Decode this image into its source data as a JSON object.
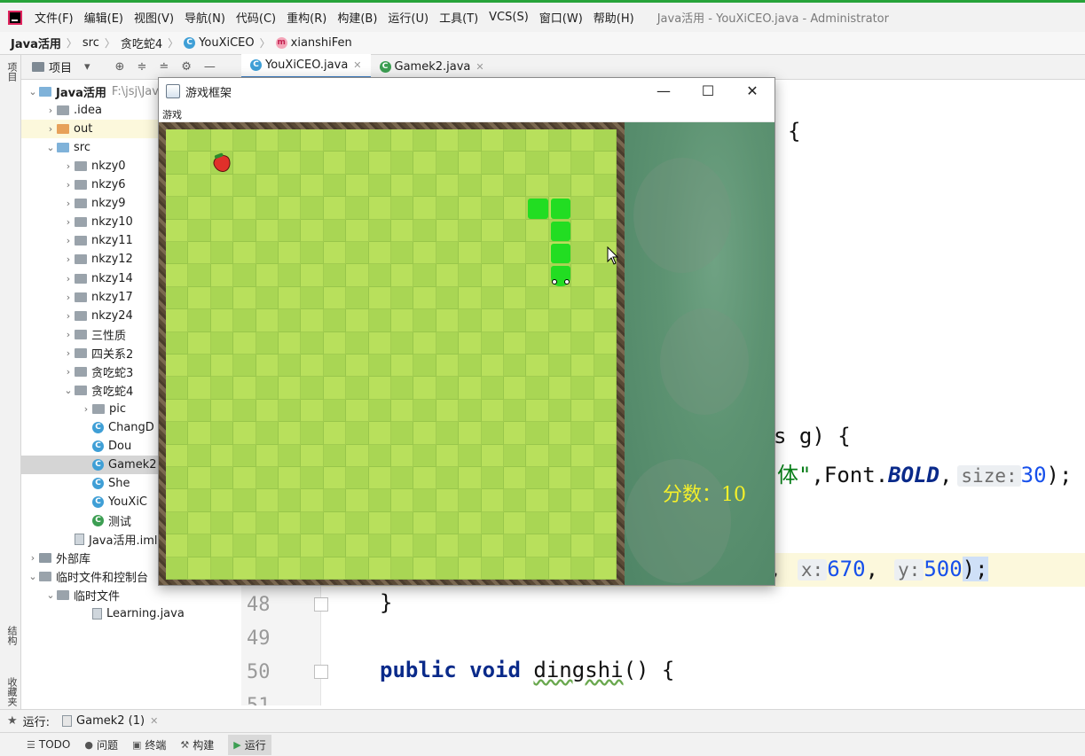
{
  "menubar": {
    "items": [
      "文件(F)",
      "编辑(E)",
      "视图(V)",
      "导航(N)",
      "代码(C)",
      "重构(R)",
      "构建(B)",
      "运行(U)",
      "工具(T)",
      "VCS(S)",
      "窗口(W)",
      "帮助(H)"
    ],
    "window_title": "Java活用 - YouXiCEO.java - Administrator"
  },
  "breadcrumb": {
    "items": [
      "Java活用",
      "src",
      "贪吃蛇4",
      "YouXiCEO",
      "xianshiFen"
    ]
  },
  "left_strip": {
    "top_tab": "项目",
    "mid_tab": "结构",
    "bottom_tab": "收藏夹"
  },
  "project_panel": {
    "title": "项目",
    "tree": [
      {
        "label": "Java活用",
        "hint": "F:\\jsj\\Java",
        "indent": 0,
        "arrow": "v",
        "icon": "folder-blue",
        "bold": true
      },
      {
        "label": ".idea",
        "indent": 1,
        "arrow": ">",
        "icon": "folder"
      },
      {
        "label": "out",
        "indent": 1,
        "arrow": ">",
        "icon": "folder-orange",
        "highlight": true
      },
      {
        "label": "src",
        "indent": 1,
        "arrow": "v",
        "icon": "folder-blue"
      },
      {
        "label": "nkzy0",
        "indent": 2,
        "arrow": ">",
        "icon": "folder"
      },
      {
        "label": "nkzy6",
        "indent": 2,
        "arrow": ">",
        "icon": "folder"
      },
      {
        "label": "nkzy9",
        "indent": 2,
        "arrow": ">",
        "icon": "folder"
      },
      {
        "label": "nkzy10",
        "indent": 2,
        "arrow": ">",
        "icon": "folder"
      },
      {
        "label": "nkzy11",
        "indent": 2,
        "arrow": ">",
        "icon": "folder"
      },
      {
        "label": "nkzy12",
        "indent": 2,
        "arrow": ">",
        "icon": "folder"
      },
      {
        "label": "nkzy14",
        "indent": 2,
        "arrow": ">",
        "icon": "folder"
      },
      {
        "label": "nkzy17",
        "indent": 2,
        "arrow": ">",
        "icon": "folder"
      },
      {
        "label": "nkzy24",
        "indent": 2,
        "arrow": ">",
        "icon": "folder"
      },
      {
        "label": "三性质",
        "indent": 2,
        "arrow": ">",
        "icon": "folder"
      },
      {
        "label": "四关系2",
        "indent": 2,
        "arrow": ">",
        "icon": "folder"
      },
      {
        "label": "贪吃蛇3",
        "indent": 2,
        "arrow": ">",
        "icon": "folder"
      },
      {
        "label": "贪吃蛇4",
        "indent": 2,
        "arrow": "v",
        "icon": "folder"
      },
      {
        "label": "pic",
        "indent": 3,
        "arrow": ">",
        "icon": "folder"
      },
      {
        "label": "ChangD",
        "indent": 3,
        "arrow": "",
        "icon": "class"
      },
      {
        "label": "Dou",
        "indent": 3,
        "arrow": "",
        "icon": "class"
      },
      {
        "label": "Gamek2",
        "indent": 3,
        "arrow": "",
        "icon": "class",
        "selected": true
      },
      {
        "label": "She",
        "indent": 3,
        "arrow": "",
        "icon": "class"
      },
      {
        "label": "YouXiC",
        "indent": 3,
        "arrow": "",
        "icon": "class"
      },
      {
        "label": "测试",
        "indent": 3,
        "arrow": "",
        "icon": "class-green"
      },
      {
        "label": "Java活用.iml",
        "indent": 2,
        "arrow": "",
        "icon": "doc"
      },
      {
        "label": "外部库",
        "indent": 0,
        "arrow": ">",
        "icon": "lib"
      },
      {
        "label": "临时文件和控制台",
        "indent": 0,
        "arrow": "v",
        "icon": "folder"
      },
      {
        "label": "临时文件",
        "indent": 1,
        "arrow": "v",
        "icon": "folder"
      },
      {
        "label": "Learning.java",
        "indent": 3,
        "arrow": "",
        "icon": "doc"
      }
    ]
  },
  "editor_tabs": [
    {
      "label": "YouXiCEO.java",
      "active": true
    },
    {
      "label": "Gamek2.java",
      "active": false
    }
  ],
  "editor": {
    "line_numbers": [
      "48",
      "49",
      "50",
      "51"
    ],
    "fragments": {
      "brace_open_1": "{",
      "sig_tail": "s g) {",
      "font_str": "体\"",
      "font_mid": ",Font.",
      "font_bold": "BOLD",
      "font_comma": ",",
      "size_hint": "size:",
      "size_val": "30",
      "font_end": ");",
      "draw_tail": "n,",
      "x_hint": "x:",
      "x_val": "670",
      "comma2": ",",
      "y_hint": "y:",
      "y_val": "500",
      "draw_end": ");",
      "close_brace": "}",
      "kw_public": "public",
      "kw_void": "void",
      "method_name": "dingshi",
      "method_tail": "() {"
    }
  },
  "run_bar": {
    "label": "运行:",
    "tab": "Gamek2 (1)"
  },
  "status_bar": {
    "tabs": [
      "TODO",
      "问题",
      "终端",
      "构建",
      "运行"
    ]
  },
  "game_window": {
    "title": "游戏框架",
    "menu": "游戏",
    "score_text": "分数：10",
    "grid_cols": 20,
    "grid_rows": 20,
    "snake_cells": [
      [
        16,
        3
      ],
      [
        17,
        3
      ],
      [
        17,
        4
      ],
      [
        17,
        5
      ],
      [
        17,
        6
      ]
    ],
    "food_cell": [
      2,
      1
    ]
  }
}
